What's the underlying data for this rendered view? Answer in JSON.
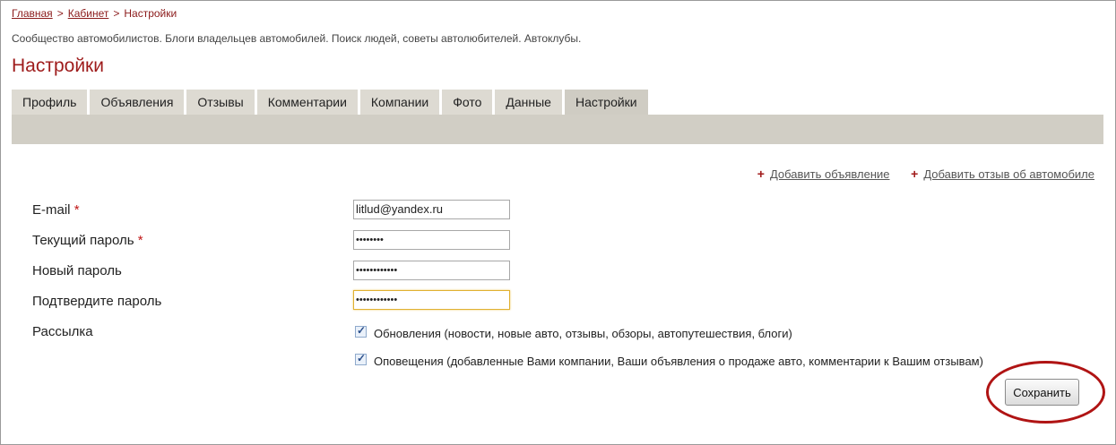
{
  "breadcrumb": {
    "home": "Главная",
    "cabinet": "Кабинет",
    "current": "Настройки",
    "separator": ">"
  },
  "tagline": "Сообщество автомобилистов. Блоги владельцев автомобилей. Поиск людей, советы автолюбителей. Автоклубы.",
  "page_title": "Настройки",
  "tabs": [
    {
      "label": "Профиль"
    },
    {
      "label": "Объявления"
    },
    {
      "label": "Отзывы"
    },
    {
      "label": "Комментарии"
    },
    {
      "label": "Компании"
    },
    {
      "label": "Фото"
    },
    {
      "label": "Данные"
    },
    {
      "label": "Настройки",
      "active": true
    }
  ],
  "links": {
    "add_ad": "Добавить объявление",
    "add_review": "Добавить отзыв об автомобиле",
    "plus": "+"
  },
  "form": {
    "required_mark": "*",
    "email_label": "E-mail",
    "email_value": "litlud@yandex.ru",
    "current_password_label": "Текущий пароль",
    "current_password_mask": "••••••••",
    "new_password_label": "Новый пароль",
    "new_password_mask": "••••••••••••",
    "confirm_password_label": "Подтвердите пароль",
    "confirm_password_mask": "••••••••••••",
    "mailing_label": "Рассылка",
    "option_updates": "Обновления (новости, новые авто, отзывы, обзоры, автопутешествия, блоги)",
    "option_updates_checked": true,
    "option_notifications": "Оповещения (добавленные Вами компании, Ваши объявления о продаже авто, комментарии к Вашим отзывам)",
    "option_notifications_checked": true,
    "save_label": "Сохранить"
  },
  "colors": {
    "accent": "#9e1b1b",
    "tab_bg": "#dddad2",
    "tab_bar": "#d1cec5",
    "highlight_ellipse": "#b01414"
  }
}
